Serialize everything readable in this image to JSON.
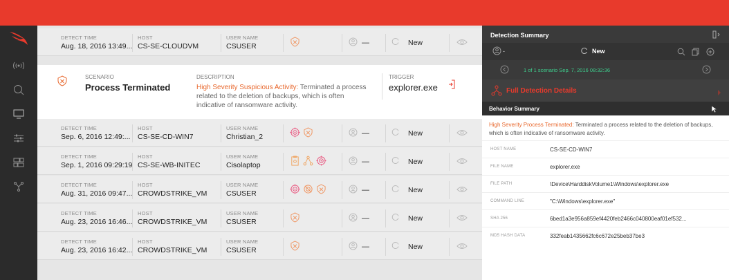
{
  "colors": {
    "accent": "#e83a2c",
    "orange": "#e8672c",
    "green": "#3ecf8e"
  },
  "rows_before": [
    {
      "detect_label": "DETECT TIME",
      "detect_value": "Aug. 18, 2016 13:49...",
      "host_label": "HOST",
      "host_value": "CS-SE-CLOUDVM",
      "user_label": "USER NAME",
      "user_value": "CSUSER",
      "severity_icons": [
        "shield-icon"
      ],
      "assignee": "—",
      "status": "New"
    }
  ],
  "expanded": {
    "scenario_label": "SCENARIO",
    "scenario_value": "Process Terminated",
    "description_label": "DESCRIPTION",
    "description_highlight": "High Severity Suspicious Activity:",
    "description_text": " Terminated a process related to the deletion of backups, which is often indicative of ransomware activity.",
    "trigger_label": "TRIGGER",
    "trigger_value": "explorer.exe"
  },
  "rows_after": [
    {
      "detect_label": "DETECT TIME",
      "detect_value": "Sep. 6, 2016 12:49:...",
      "host_label": "HOST",
      "host_value": "CS-SE-CD-WIN7",
      "user_label": "USER NAME",
      "user_value": "Christian_2",
      "severity_icons": [
        "target-icon",
        "shield-icon"
      ],
      "assignee": "—",
      "status": "New"
    },
    {
      "detect_label": "DETECT TIME",
      "detect_value": "Sep. 1, 2016 09:29:19",
      "host_label": "HOST",
      "host_value": "CS-SE-WB-INITEC",
      "user_label": "USER NAME",
      "user_value": "Cisolaptop",
      "severity_icons": [
        "clipboard-icon",
        "network-icon",
        "target-icon"
      ],
      "assignee": "—",
      "status": "New"
    },
    {
      "detect_label": "DETECT TIME",
      "detect_value": "Aug. 31, 2016 09:47...",
      "host_label": "HOST",
      "host_value": "CROWDSTRIKE_VM",
      "user_label": "USER NAME",
      "user_value": "CSUSER",
      "severity_icons": [
        "target-icon",
        "crossed-target-icon",
        "shield-icon"
      ],
      "assignee": "—",
      "status": "New"
    },
    {
      "detect_label": "DETECT TIME",
      "detect_value": "Aug. 23, 2016 16:46...",
      "host_label": "HOST",
      "host_value": "CROWDSTRIKE_VM",
      "user_label": "USER NAME",
      "user_value": "CSUSER",
      "severity_icons": [
        "shield-icon"
      ],
      "assignee": "—",
      "status": "New"
    },
    {
      "detect_label": "DETECT TIME",
      "detect_value": "Aug. 23, 2016 16:42...",
      "host_label": "HOST",
      "host_value": "CROWDSTRIKE_VM",
      "user_label": "USER NAME",
      "user_value": "CSUSER",
      "severity_icons": [
        "shield-icon"
      ],
      "assignee": "—",
      "status": "New"
    }
  ],
  "panel": {
    "title": "Detection Summary",
    "tools_status": "New",
    "scenario_nav": "1 of 1 scenario Sep. 7, 2016 08:32:36",
    "full_details": "Full Detection Details",
    "behavior_title": "Behavior Summary",
    "behavior_highlight": "High Severity Process Terminated:",
    "behavior_text": " Terminated a process related to the deletion of backups, which is often indicative of ransomware activity.",
    "fields": [
      {
        "key": "HOST NAME",
        "value": "CS-SE-CD-WIN7"
      },
      {
        "key": "FILE NAME",
        "value": "explorer.exe"
      },
      {
        "key": "FILE PATH",
        "value": "\\Device\\HarddiskVolume1\\Windows\\explorer.exe"
      },
      {
        "key": "COMMAND LINE",
        "value": "\"C:\\Windows\\explorer.exe\""
      },
      {
        "key": "SHA 256",
        "value": "6bed1a3e956a859ef4420feb2466c040800eaf01ef532..."
      },
      {
        "key": "MD5 HASH DATA",
        "value": "332feab1435662fc6c672e25beb37be3"
      }
    ]
  },
  "sidebar": {
    "items": [
      "crowdstrike-falcon-logo",
      "activity-icon",
      "search-icon",
      "monitor-icon",
      "sliders-icon",
      "dashboard-icon",
      "network-icon"
    ]
  }
}
